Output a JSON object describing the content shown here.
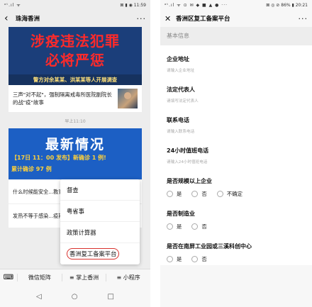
{
  "left_phone": {
    "status": {
      "signal": "ᵃᵗ.ıl ᯤ",
      "right": "⊠ ▮ ◉ 11:59"
    },
    "nav": {
      "back": "‹",
      "title": "珠海香洲",
      "more": "···"
    },
    "article1": {
      "hero_line1": "涉疫违法犯罪",
      "hero_line2": "必将严惩",
      "hero_caption": "警方对余某某、洪某某等人开展调查",
      "sub_text": "三声\"对不起\"，强制隔离戒毒所医院副院长的战\"疫\"故事"
    },
    "timestamp": "早上11:10",
    "article2": {
      "hero_big": "最新情况",
      "hero_line1": "【17日 11：00 发布】新确诊 1 例!",
      "hero_line2": "累计确诊 97 例",
      "row1": "什么时候能安全...教育厅发出最新...",
      "row2": "发热不等于感染...疫期间 9 个体温..."
    },
    "popup_menu": [
      "督查",
      "粤省事",
      "政策计算器",
      "香洲复工备案平台"
    ],
    "bottom_menu": {
      "keyboard": "⌨",
      "items": [
        "微信矩阵",
        "≡ 掌上香洲",
        "≡ 小程序"
      ]
    },
    "sys_nav": [
      "◁",
      "○",
      "□"
    ]
  },
  "right_phone": {
    "status": {
      "signal": "ᵃᵗ.ıl ᯤ ⊙ ✉ ◆ ■ ▲ ● ···",
      "right": "⊠ ◎ ⊘ 86% ▮ 20:21"
    },
    "nav": {
      "close": "✕",
      "title": "香洲区复工备案平台",
      "more": "···"
    },
    "section_header": "基本信息",
    "fields": [
      {
        "label": "企业地址",
        "placeholder": "请输入企业地址"
      },
      {
        "label": "法定代表人",
        "placeholder": "请填写法定代表人"
      },
      {
        "label": "联系电话",
        "placeholder": "请输入联系电话"
      },
      {
        "label": "24小时值班电话",
        "placeholder": "请输入24小时值班电话"
      }
    ],
    "radio_groups": [
      {
        "label": "是否规模以上企业",
        "options": [
          "是",
          "否",
          "不确定"
        ]
      },
      {
        "label": "是否制造业",
        "options": [
          "是",
          "否"
        ]
      },
      {
        "label": "是否在南屏工业园或三溪科创中心",
        "options": [
          "是",
          "否"
        ]
      }
    ]
  }
}
